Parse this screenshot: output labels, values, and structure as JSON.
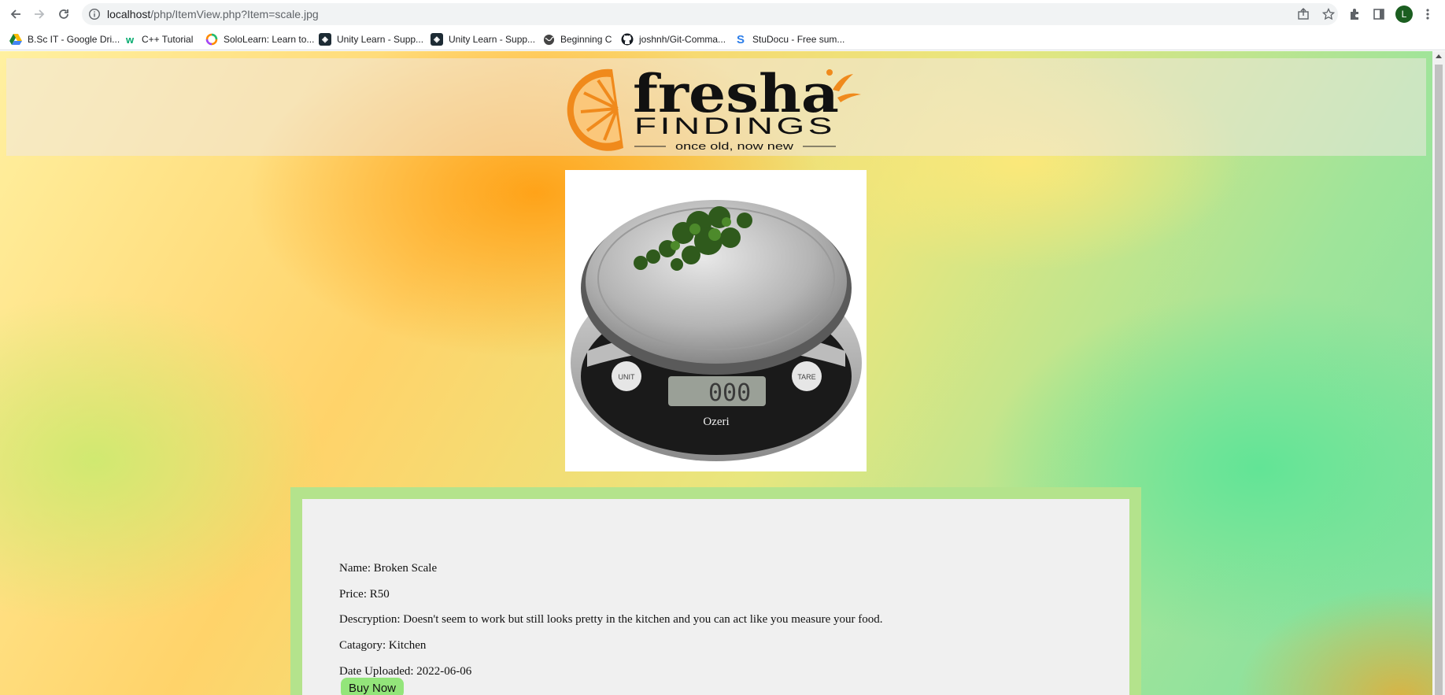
{
  "browser": {
    "url_host": "localhost",
    "url_path": "/php/ItemView.php?Item=scale.jpg",
    "profile_initial": "L"
  },
  "bookmarks": [
    {
      "label": "B.Sc IT - Google Dri...",
      "icon": "google-drive-icon"
    },
    {
      "label": "C++ Tutorial",
      "icon": "w3schools-icon"
    },
    {
      "label": "SoloLearn: Learn to...",
      "icon": "sololearn-icon"
    },
    {
      "label": "Unity Learn - Supp...",
      "icon": "unity-icon"
    },
    {
      "label": "Unity Learn - Supp...",
      "icon": "unity-icon"
    },
    {
      "label": "Beginning C",
      "icon": "globe-icon"
    },
    {
      "label": "joshnh/Git-Comma...",
      "icon": "github-icon"
    },
    {
      "label": "StuDocu - Free sum...",
      "icon": "studocu-icon"
    }
  ],
  "logo": {
    "word1": "fresha",
    "word2": "FINDINGS",
    "tagline": "once old, now new"
  },
  "product_image": {
    "brand_text": "Ozeri",
    "unit_button": "UNIT",
    "tare_button": "TARE",
    "display_text": "000"
  },
  "item": {
    "name": "Name: Broken Scale",
    "price": "Price: R50",
    "description": "Descryption: Doesn't seem to work but still looks pretty in the kitchen and you can act like you measure your food.",
    "category": "Catagory: Kitchen",
    "date_uploaded": "Date Uploaded: 2022-06-06",
    "buy_label": "Buy Now"
  }
}
